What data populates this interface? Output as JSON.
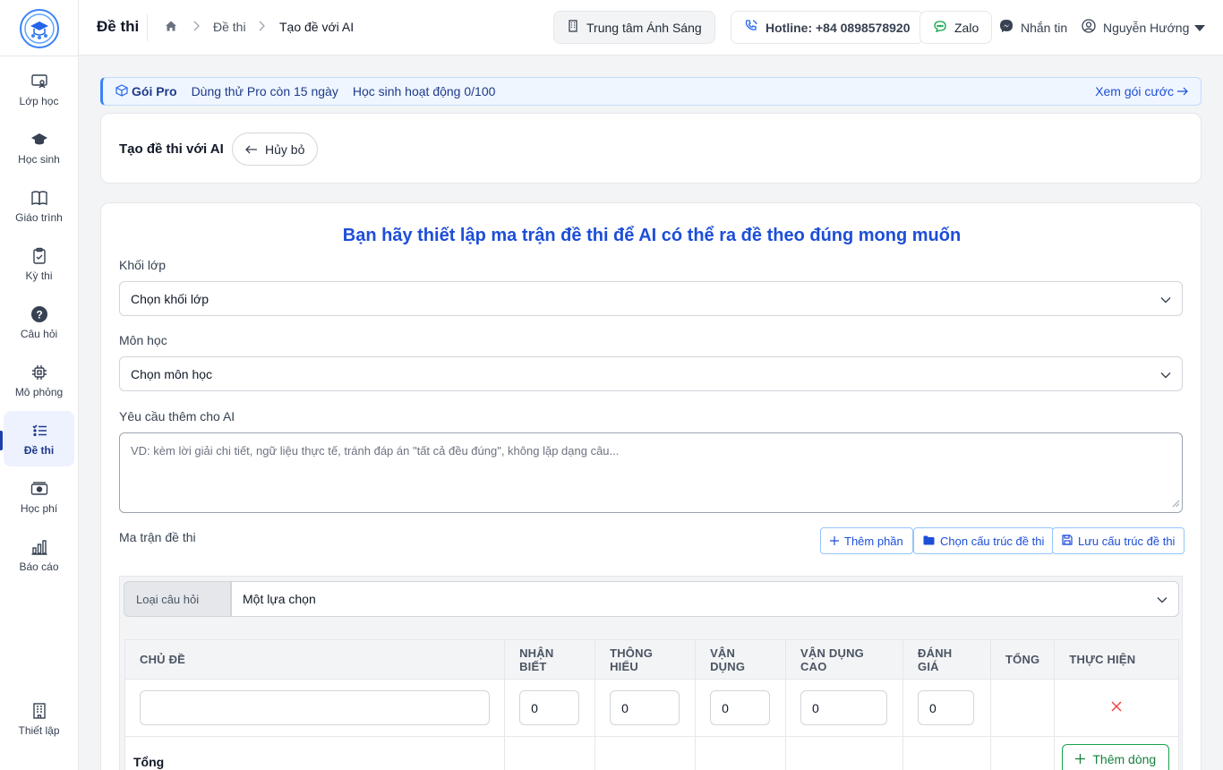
{
  "header": {
    "title": "Đề thi",
    "breadcrumb": [
      "Đề thi",
      "Tạo đề với AI"
    ],
    "center": "Trung tâm Ánh Sáng",
    "hotline": "Hotline: +84 0898578920",
    "zalo": "Zalo",
    "message": "Nhắn tin",
    "user": "Nguyễn Hướng"
  },
  "sidebar": {
    "items": [
      {
        "label": "Lớp học",
        "icon": "classroom-icon"
      },
      {
        "label": "Học sinh",
        "icon": "graduation-cap-icon"
      },
      {
        "label": "Giáo trình",
        "icon": "book-icon"
      },
      {
        "label": "Kỳ thi",
        "icon": "clipboard-check-icon"
      },
      {
        "label": "Câu hỏi",
        "icon": "question-circle-icon"
      },
      {
        "label": "Mô phỏng",
        "icon": "chip-icon"
      },
      {
        "label": "Đề thi",
        "icon": "list-icon"
      },
      {
        "label": "Học phí",
        "icon": "money-icon"
      },
      {
        "label": "Báo cáo",
        "icon": "bar-chart-icon"
      },
      {
        "label": "Thiết lập",
        "icon": "building-icon"
      }
    ],
    "active_index": 6
  },
  "banner": {
    "plan": "Gói Pro",
    "trial": "Dùng thử Pro còn 15 ngày",
    "students": "Học sinh hoạt động 0/100",
    "link": "Xem gói cước"
  },
  "top_card": {
    "title": "Tạo đề thi với AI",
    "cancel": "Hủy bỏ"
  },
  "form": {
    "heading": "Bạn hãy thiết lập ma trận đề thi để AI có thể ra đề theo đúng mong muốn",
    "grade_label": "Khối lớp",
    "grade_value": "Chọn khối lớp",
    "subject_label": "Môn học",
    "subject_value": "Chọn môn học",
    "ai_label": "Yêu cầu thêm cho AI",
    "ai_placeholder": "VD: kèm lời giải chi tiết, ngữ liệu thực tế, tránh đáp án \"tất cả đều đúng\", không lặp dạng câu...",
    "matrix_label": "Ma trận đề thi",
    "add_section": "Thêm phần",
    "choose_structure": "Chọn cấu trúc đề thi",
    "save_structure": "Lưu cấu trúc đề thi"
  },
  "matrix": {
    "question_type_label": "Loại câu hỏi",
    "question_type_value": "Một lựa chọn",
    "columns": [
      "CHỦ ĐỀ",
      "NHẬN BIẾT",
      "THÔNG HIỂU",
      "VẬN DỤNG",
      "VẬN DỤNG CAO",
      "ĐÁNH GIÁ",
      "TỔNG",
      "THỰC HIỆN"
    ],
    "row_values": [
      "0",
      "0",
      "0",
      "0",
      "0"
    ],
    "total_label": "Tổng",
    "add_row": "Thêm dòng"
  },
  "colors": {
    "primary": "#1d4ed8",
    "danger": "#ef4444",
    "success": "#16a34a"
  }
}
